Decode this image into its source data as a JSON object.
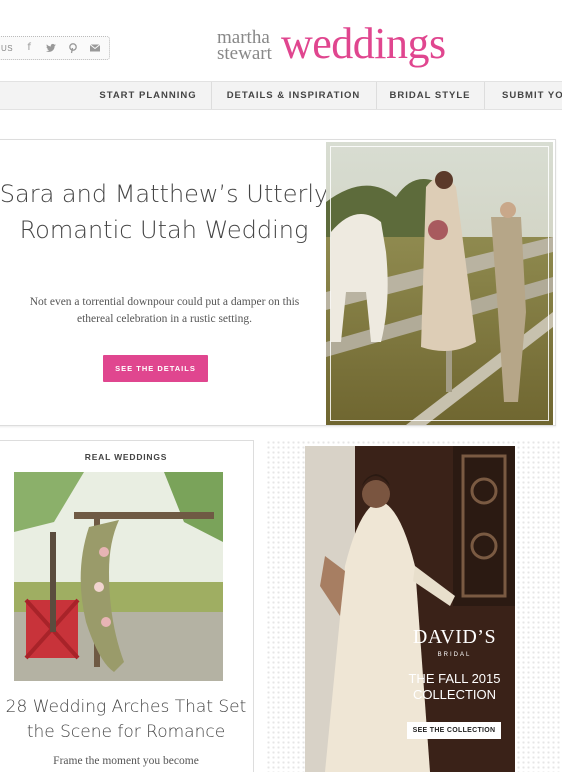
{
  "header": {
    "follow_label": "US",
    "social_icons": [
      "facebook-icon",
      "twitter-icon",
      "pinterest-icon",
      "email-icon"
    ],
    "logo": {
      "line1": "martha",
      "line2": "stewart",
      "wordmark": "weddings"
    }
  },
  "nav": {
    "items": [
      {
        "label": "START PLANNING"
      },
      {
        "label": "DETAILS & INSPIRATION"
      },
      {
        "label": "BRIDAL STYLE"
      },
      {
        "label": "SUBMIT YOU"
      }
    ]
  },
  "hero": {
    "title": "Sara and Matthew’s Utterly Romantic Utah Wedding",
    "description": "Not even a torrential downpour could put a damper on this ethereal celebration in a rustic setting.",
    "button_label": "SEE THE DETAILS"
  },
  "card": {
    "category": "REAL WEDDINGS",
    "title": "28 Wedding Arches That Set the Scene for Romance",
    "description": "Frame the moment you become"
  },
  "ad": {
    "brand": "DAVID’S",
    "brand_sub": "BRIDAL",
    "collection": "THE FALL 2015 COLLECTION",
    "button_label": "SEE THE COLLECTION"
  },
  "colors": {
    "accent": "#e0468f",
    "nav_bg": "#f3f3f3",
    "text": "#444444"
  }
}
